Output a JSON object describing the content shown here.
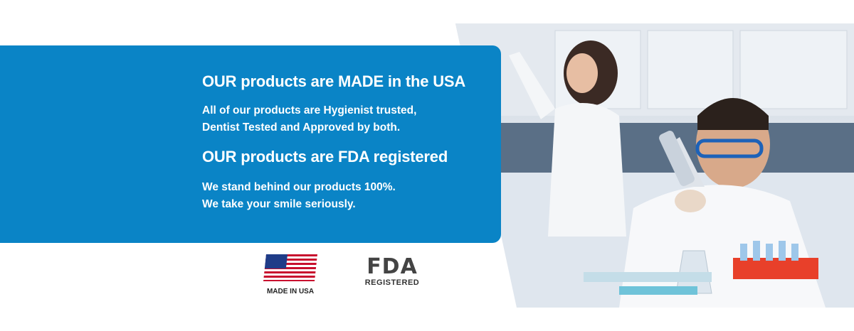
{
  "banner": {
    "heading_1": "OUR products are MADE in the USA",
    "line_1a": "All of our products are Hygienist trusted,",
    "line_1b": "Dentist Tested and Approved by both.",
    "heading_2": "OUR products are FDA registered",
    "line_2a": "We stand behind our products 100%.",
    "line_2b": "We take your smile seriously."
  },
  "badges": {
    "usa_label": "MADE IN USA",
    "fda_letters": "FDA",
    "fda_label": "REGISTERED"
  },
  "colors": {
    "banner_blue": "#0a84c6",
    "flag_red": "#c8102e",
    "flag_blue": "#1f3c88"
  },
  "image": {
    "icon": "lab-photo"
  }
}
